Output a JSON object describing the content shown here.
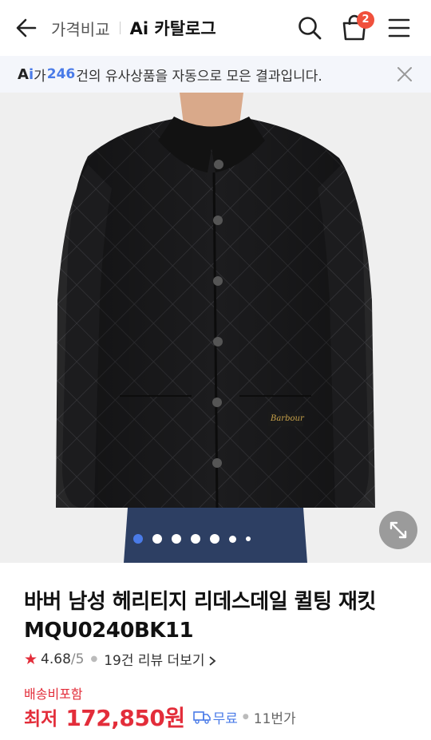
{
  "header": {
    "category": "가격비교",
    "catalog": "Ai 카탈로그",
    "cart_count": "2"
  },
  "banner": {
    "ai_label_a": "A",
    "ai_label_i": "i",
    "prefix": "가",
    "count": "246",
    "suffix": "건의 유사상품을 자동으로 모은 결과입니다."
  },
  "gallery": {
    "brand_label": "Barbour",
    "total_images": 7,
    "active_index": 1
  },
  "product": {
    "title": "바버 남성 헤리티지 리데스데일 퀼팅 재킷 MQU0240BK11",
    "rating": "4.68",
    "rating_max": "/5",
    "reviews": "19건 리뷰 더보기",
    "shipping": "배송비포함",
    "price_label": "최저",
    "price": "172,850원",
    "delivery": "무료",
    "mall": "11번가"
  },
  "colors": {
    "accent": "#4a7be8",
    "price": "#e32d3a",
    "badge": "#f0503c"
  }
}
